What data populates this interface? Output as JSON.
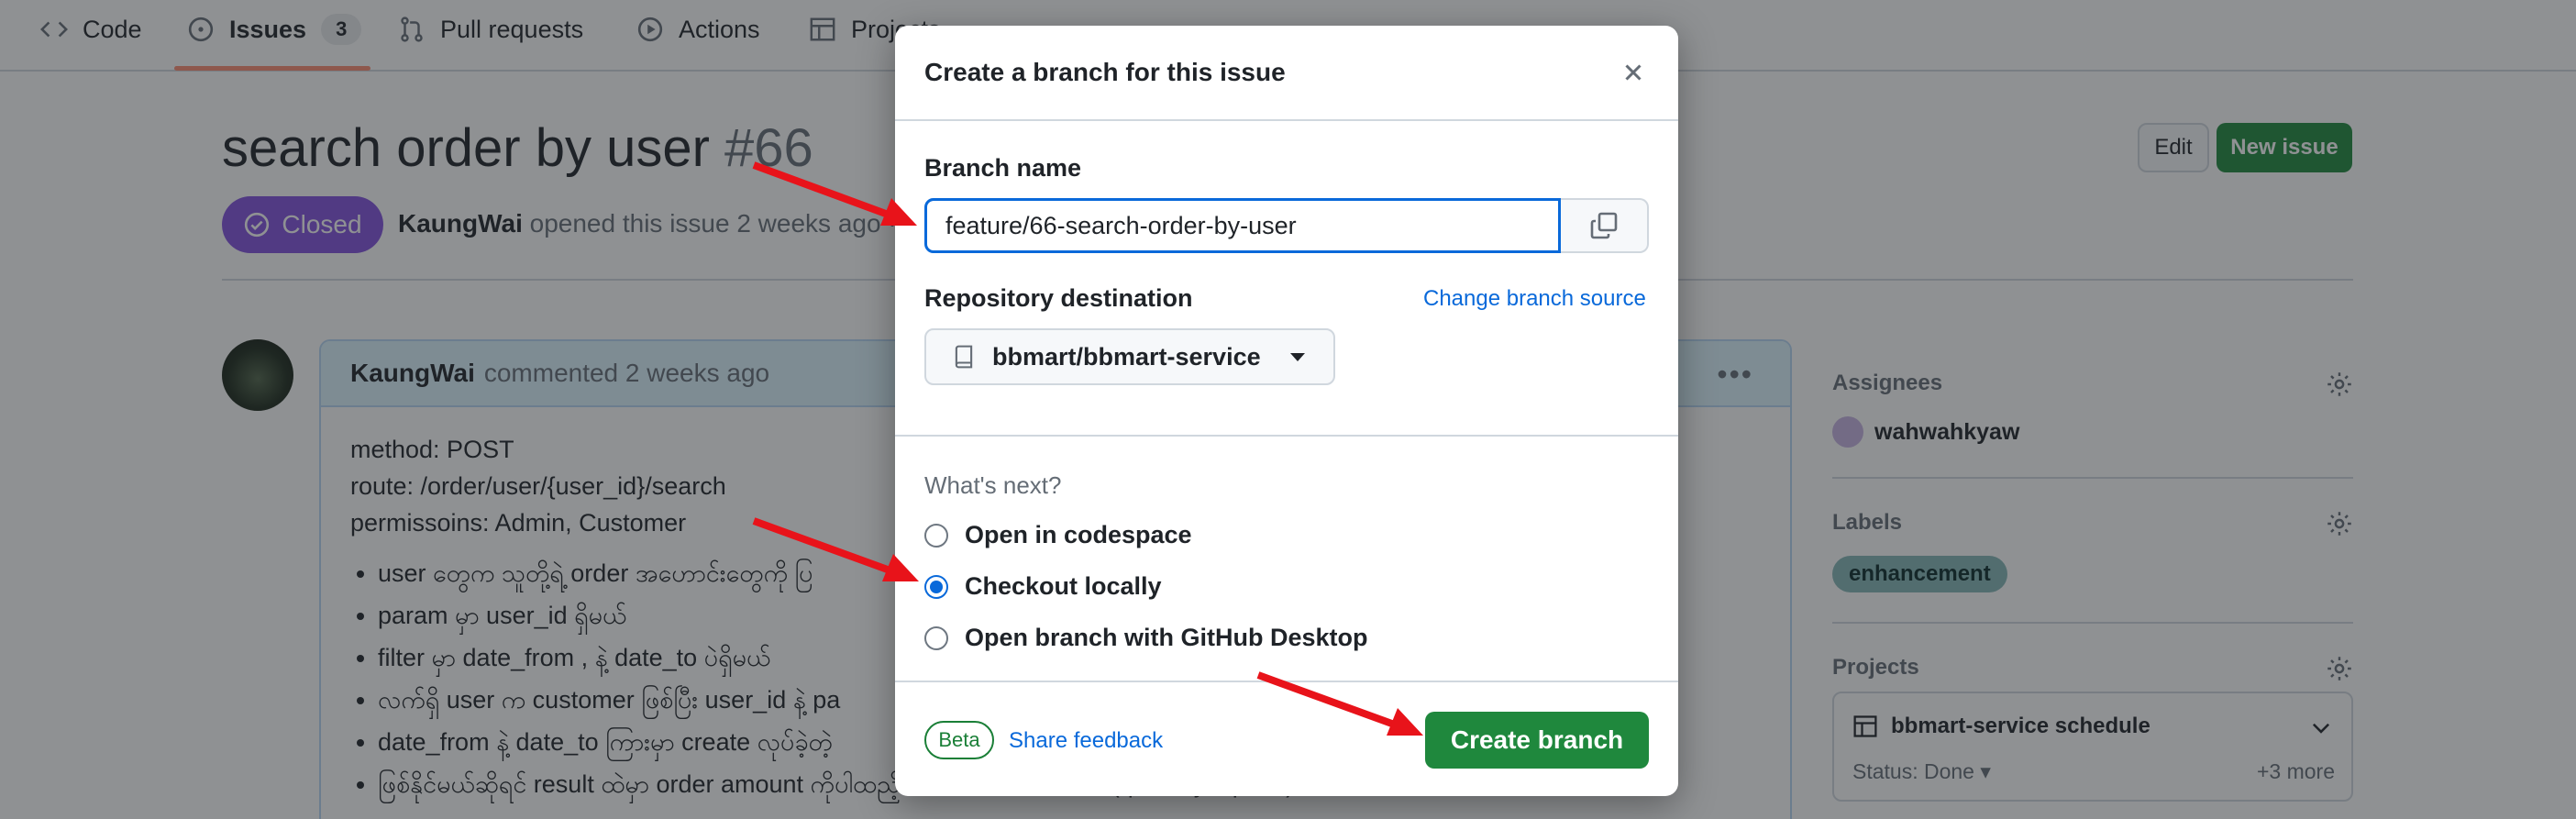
{
  "repo_nav": {
    "tabs": [
      {
        "label": "Code",
        "icon": "code-icon"
      },
      {
        "label": "Issues",
        "count": "3",
        "icon": "issue-opened-icon"
      },
      {
        "label": "Pull requests",
        "icon": "git-pull-request-icon"
      },
      {
        "label": "Actions",
        "icon": "play-icon"
      },
      {
        "label": "Projects",
        "icon": "table-icon"
      }
    ]
  },
  "issue": {
    "title": "search order by user",
    "number": "#66",
    "state": "Closed",
    "author": "KaungWai",
    "meta_text": "opened this issue 2 weeks ago ·",
    "edit_label": "Edit",
    "new_issue_label": "New issue"
  },
  "comment": {
    "author": "KaungWai",
    "time": "commented 2 weeks ago",
    "lines": [
      "method: POST",
      "route: /order/user/{user_id}/search",
      "permissoins: Admin, Customer"
    ],
    "bullets": [
      "user တွေက သူတို့ရဲ့ order အဟောင်းတွေကို ပြ",
      "param မှာ user_id ရှိမယ်",
      "filter မှာ date_from , နဲ့ date_to ပဲရှိမယ်",
      "လက်ရှိ user က customer ဖြစ်ပြီး user_id နဲ့ pa",
      "date_from နဲ့ date_to ကြားမှာ create လုပ်ခဲ့တဲ့",
      "ဖြစ်နိုင်မယ်ဆိုရင် result ထဲမှာ order amount ကိုပါထည့်ပေးထားတယ် sum of (quantity x price) of order details"
    ]
  },
  "sidebar": {
    "assignees_label": "Assignees",
    "assignee": "wahwahkyaw",
    "labels_label": "Labels",
    "label": "enhancement",
    "projects_label": "Projects",
    "project_name": "bbmart-service schedule",
    "project_status": "Status: Done",
    "project_more": "+3 more"
  },
  "modal": {
    "title": "Create a branch for this issue",
    "branch_name_label": "Branch name",
    "branch_name_value": "feature/66-search-order-by-user",
    "repo_dest_label": "Repository destination",
    "change_source_link": "Change branch source",
    "repo_value": "bbmart/bbmart-service",
    "whats_next": "What's next?",
    "options": [
      {
        "label": "Open in codespace",
        "selected": false
      },
      {
        "label": "Checkout locally",
        "selected": true
      },
      {
        "label": "Open branch with GitHub Desktop",
        "selected": false
      }
    ],
    "beta_label": "Beta",
    "feedback_link": "Share feedback",
    "create_label": "Create branch"
  },
  "colors": {
    "accent": "#0969da",
    "success": "#1f883d",
    "closed": "#8250df",
    "arrow": "#e8131a"
  }
}
